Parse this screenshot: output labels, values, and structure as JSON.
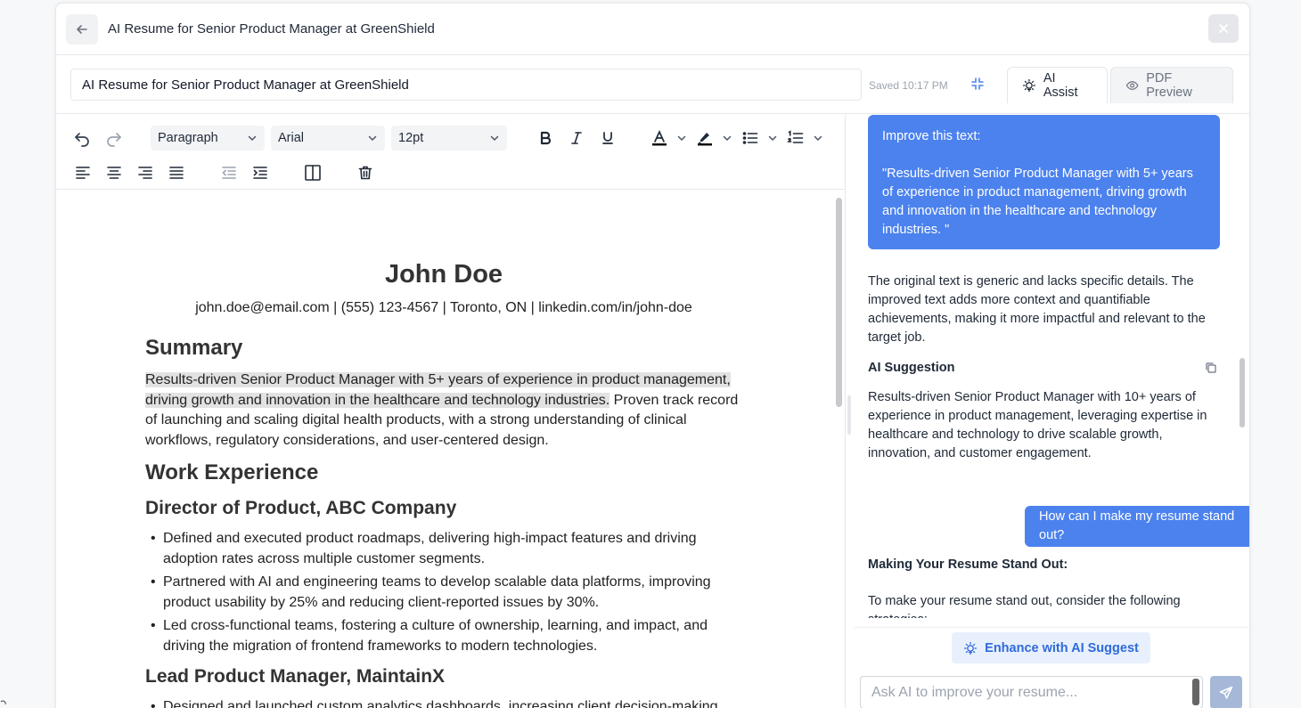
{
  "header": {
    "title": "AI Resume for Senior Product Manager at GreenShield"
  },
  "titlebar": {
    "title_value": "AI Resume for Senior Product Manager at GreenShield",
    "saved": "Saved 10:17 PM",
    "tabs": [
      {
        "label": "AI Assist",
        "icon": "bulb-icon",
        "active": true
      },
      {
        "label": "PDF Preview",
        "icon": "eye-icon",
        "active": false
      }
    ]
  },
  "toolbar": {
    "block_style": "Paragraph",
    "font_family": "Arial",
    "font_size": "12pt"
  },
  "document": {
    "name": "John Doe",
    "contact": "john.doe@email.com | (555) 123-4567 | Toronto, ON | linkedin.com/in/john-doe",
    "summary_heading": "Summary",
    "summary_highlight_1": "Results-driven Senior Product Manager with 5+ years of experience in product management,",
    "summary_highlight_2": "driving growth and innovation in the healthcare and technology industries.",
    "summary_rest_1": " Proven track record",
    "summary_rest_2": "of launching and scaling digital health products, with a strong understanding of clinical",
    "summary_rest_3": "workflows, regulatory considerations, and user-centered design.",
    "work_heading": "Work Experience",
    "job1_title": "Director of Product, ABC Company",
    "job1_bullets": [
      "Defined and executed product roadmaps, delivering high-impact features and driving adoption rates across multiple customer segments.",
      "Partnered with AI and engineering teams to develop scalable data platforms, improving product usability by 25% and reducing client-reported issues by 30%.",
      "Led cross-functional teams, fostering a culture of ownership, learning, and impact, and driving the migration of frontend frameworks to modern technologies."
    ],
    "job2_title": "Lead Product Manager, MaintainX",
    "job2_bullets": [
      "Designed and launched custom analytics dashboards, increasing client decision-making"
    ]
  },
  "ai": {
    "user_msg_1_line1": "Improve this text:",
    "user_msg_1_line2": "\"Results-driven Senior Product Manager with 5+ years of experience in product management, driving growth and innovation in the healthcare and technology industries. \"",
    "response_1": "The original text is generic and lacks specific details. The improved text adds more context and quantifiable achievements, making it more impactful and relevant to the target job.",
    "suggestion_label": "AI Suggestion",
    "suggestion_text": "Results-driven Senior Product Manager with 10+ years of experience in product management, leveraging expertise in healthcare and technology to drive scalable growth, innovation, and customer engagement.",
    "user_msg_2": "How can I make my resume stand out?",
    "response_2_heading": "Making Your Resume Stand Out:",
    "response_2_text": "To make your resume stand out, consider the following strategies:",
    "enhance_label": "Enhance with AI Suggest",
    "input_placeholder": "Ask AI to improve your resume..."
  },
  "colors": {
    "accent": "#4c82ee",
    "enhance_bg": "#e8f0fd",
    "enhance_text": "#2f6ad9",
    "send_bg": "#a5b8d8"
  }
}
